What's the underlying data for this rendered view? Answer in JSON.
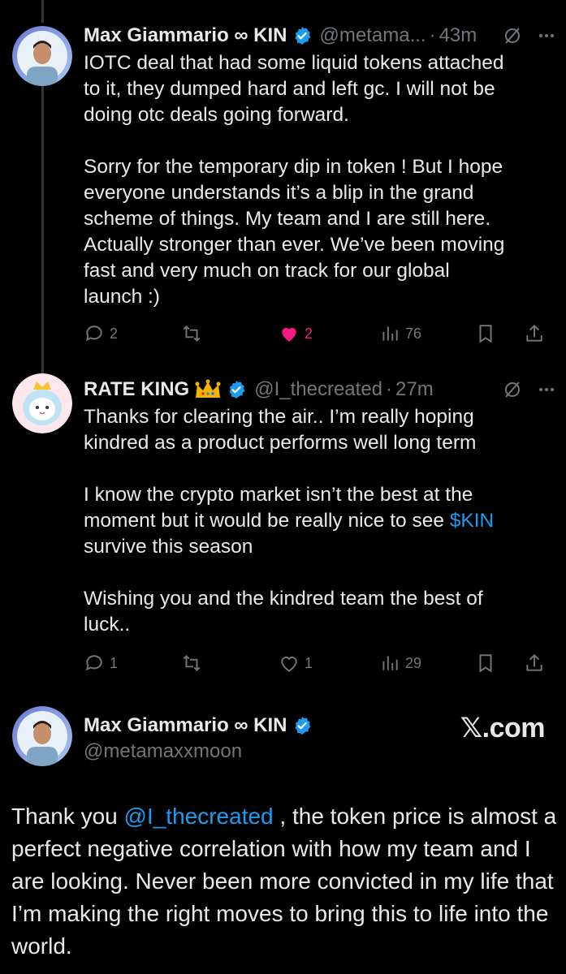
{
  "tweet1": {
    "name": "Max Giammario ∞ KIN",
    "handle": "@metama...",
    "dot": "·",
    "time": "43m",
    "lines": [
      "IOTC deal that had some liquid tokens attached",
      "to it, they dumped hard and left gc. I will not be",
      "doing otc deals going forward."
    ],
    "lines2": [
      "Sorry for the temporary dip in token ! But I hope",
      "everyone understands it’s a blip in the grand",
      "scheme of things. My team and I are still here.",
      "Actually stronger than ever. We’ve been moving",
      "fast and very much on track for our global",
      "launch :)"
    ],
    "replies": "2",
    "likes": "2",
    "views": "76"
  },
  "tweet2": {
    "name": "RATE KING",
    "handle": "@I_thecreated",
    "dot": "·",
    "time": "27m",
    "lines": [
      "Thanks for clearing the air.. I’m really hoping",
      "kindred as a product performs well long term"
    ],
    "line3a": "I know the crypto market isn’t the best at the",
    "line3b": "moment but it would be really nice to see ",
    "cashtag": "$KIN",
    "line3c": "survive this season",
    "lines4": [
      "Wishing you and the kindred team the best of",
      "luck.."
    ],
    "replies": "1",
    "likes": "1",
    "views": "29"
  },
  "tweet3": {
    "name": "Max Giammario ∞ KIN",
    "handle": "@metamaxxmoon",
    "watermark": "𝕏.com",
    "text_pre": "Thank you ",
    "mention": "@I_thecreated",
    "text_post": " , the token price is almost a perfect negative correlation with how my team and I are looking. Never been more convicted in my life that I’m making the right moves to bring this to life into the world."
  },
  "colors": {
    "background": "#000000",
    "text": "#e7e9ea",
    "muted": "#71767b",
    "accent": "#1d9bf0",
    "like": "#f91880"
  },
  "icons": [
    "verified-badge-icon",
    "grok-icon",
    "more-icon",
    "reply-icon",
    "retweet-icon",
    "like-icon",
    "views-icon",
    "bookmark-icon",
    "share-icon",
    "crown-icon"
  ]
}
